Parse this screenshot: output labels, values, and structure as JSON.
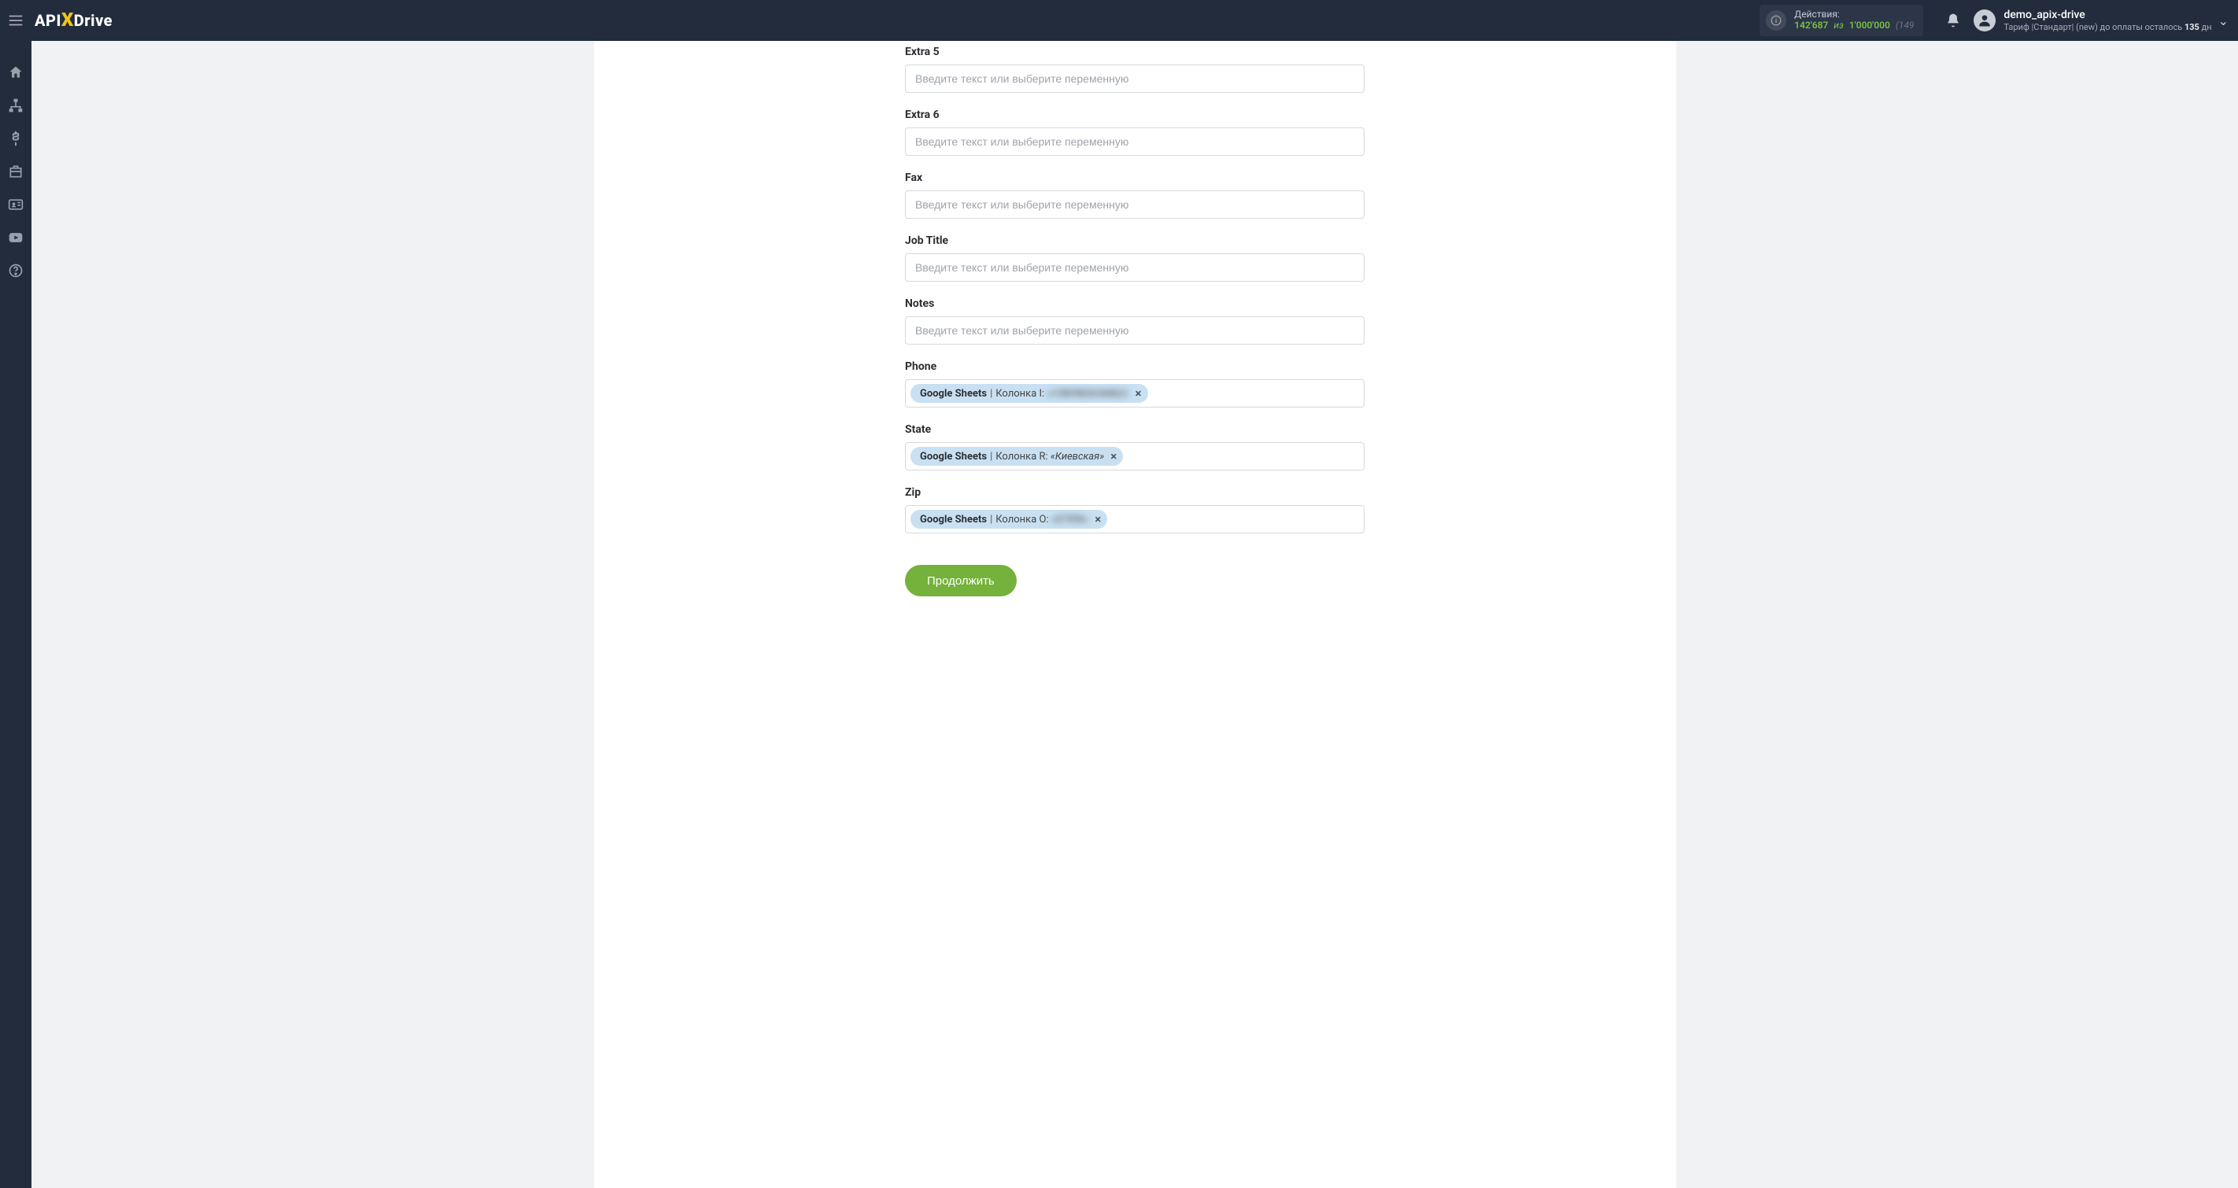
{
  "brand": {
    "prefix": "API",
    "x": "X",
    "suffix": "Drive"
  },
  "header": {
    "actions_label": "Действия:",
    "actions_current": "142'687",
    "actions_sep": "из",
    "actions_limit": "1'000'000",
    "actions_extra": "(149",
    "user_name": "demo_apix-drive",
    "tariff_prefix": "Тариф |Стандарт| (new) до оплаты осталось ",
    "tariff_days": "135",
    "tariff_suffix": " дн"
  },
  "form": {
    "placeholder": "Введите текст или выберите переменную",
    "fields": {
      "extra5": {
        "label": "Extra 5"
      },
      "extra6": {
        "label": "Extra 6"
      },
      "fax": {
        "label": "Fax"
      },
      "job": {
        "label": "Job Title"
      },
      "notes": {
        "label": "Notes"
      },
      "phone": {
        "label": "Phone",
        "tag": {
          "source": "Google Sheets",
          "column": "Колонка I:",
          "value": "«+380982636862»",
          "blur": true
        }
      },
      "state": {
        "label": "State",
        "tag": {
          "source": "Google Sheets",
          "column": "Колонка R:",
          "value": "«Киевская»",
          "blur": false
        }
      },
      "zip": {
        "label": "Zip",
        "tag": {
          "source": "Google Sheets",
          "column": "Колонка O:",
          "value": "«07556»",
          "blur": true
        }
      }
    },
    "continue_label": "Продолжить"
  }
}
